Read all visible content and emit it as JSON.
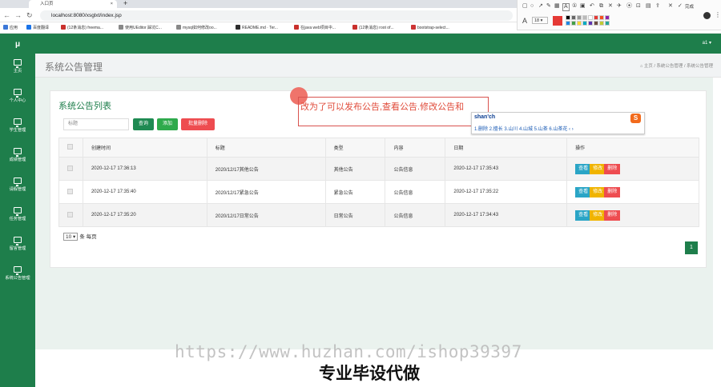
{
  "browser": {
    "tab_title": "入口页",
    "url": "localhost:8080/xsglxt/index.jsp",
    "bookmarks": [
      "应用",
      "百度翻译",
      "(12条消息) freema...",
      "使用UEditor 踩坑C...",
      "mysql如何修改oo...",
      "README.md · Ter...",
      "在java web项目中...",
      "(12条消息) root of...",
      "bootstrap-select..."
    ],
    "bookmark_colors": [
      "#3c78d8",
      "#1a73e8",
      "#c9302c",
      "#888888",
      "#888888",
      "#2d2d2d",
      "#c9302c",
      "#c9302c",
      "#cc3333"
    ]
  },
  "annotation_tool": {
    "font_size": "18",
    "font_label": "A",
    "done_label": "完成",
    "swatches": [
      "#000000",
      "#666666",
      "#999999",
      "#bbbbbb",
      "#ffffff",
      "#e53935",
      "#f4511e",
      "#8e24aa",
      "#1e88e5",
      "#43a047",
      "#fdd835",
      "#00acc1",
      "#5e35b1",
      "#6d4c41",
      "#c0ca33",
      "#26a69a"
    ],
    "current_color": "#e53935"
  },
  "sidebar": {
    "logo": "μ",
    "items": [
      {
        "label": "主页",
        "icon": "dashboard-icon"
      },
      {
        "label": "个人中心",
        "icon": "monitor-icon"
      },
      {
        "label": "学生管理",
        "icon": "monitor-icon"
      },
      {
        "label": "成绩管理",
        "icon": "monitor-icon"
      },
      {
        "label": "请假管理",
        "icon": "monitor-icon"
      },
      {
        "label": "任务管理",
        "icon": "monitor-icon"
      },
      {
        "label": "留言管理",
        "icon": "monitor-icon"
      },
      {
        "label": "系统公告管理",
        "icon": "monitor-icon"
      }
    ]
  },
  "topbar": {
    "user": "a1 ▾"
  },
  "page": {
    "title": "系统公告管理",
    "breadcrumb": "主页  /  系统公告管理  /  系统公告管理"
  },
  "panel": {
    "title": "系统公告列表",
    "search_placeholder": "标题",
    "buttons": {
      "query": "查询",
      "add": "添加",
      "batch_delete": "批量删除"
    },
    "columns": [
      "",
      "创建时间",
      "标题",
      "类型",
      "内容",
      "日期",
      "操作"
    ],
    "rows": [
      {
        "created": "2020-12-17 17:36:13",
        "title": "2020/12/17其他公告",
        "type": "其他公告",
        "content": "公告信息",
        "date": "2020-12-17 17:35:43"
      },
      {
        "created": "2020-12-17 17:35:40",
        "title": "2020/12/17紧急公告",
        "type": "紧急公告",
        "content": "公告信息",
        "date": "2020-12-17 17:35:22"
      },
      {
        "created": "2020-12-17 17:35:20",
        "title": "2020/12/17日常公告",
        "type": "日常公告",
        "content": "公告信息",
        "date": "2020-12-17 17:34:43"
      }
    ],
    "row_actions": {
      "view": "查看",
      "edit": "修改",
      "delete": "删除"
    },
    "page_size": "10",
    "page_size_suffix": "条 每页",
    "current_page": "1"
  },
  "overlay": {
    "annotation_text": "改为了可以发布公告,查看公告.修改公告和",
    "ime_input": "shan'ch",
    "ime_candidates": "1.删除  2.擅长  3.山川  4.山城  5.山茶  6.山茶花   ‹ ›",
    "ime_logo": "S"
  },
  "watermark": {
    "url": "https://www.huzhan.com/ishop39397",
    "caption": "专业毕设代做"
  }
}
